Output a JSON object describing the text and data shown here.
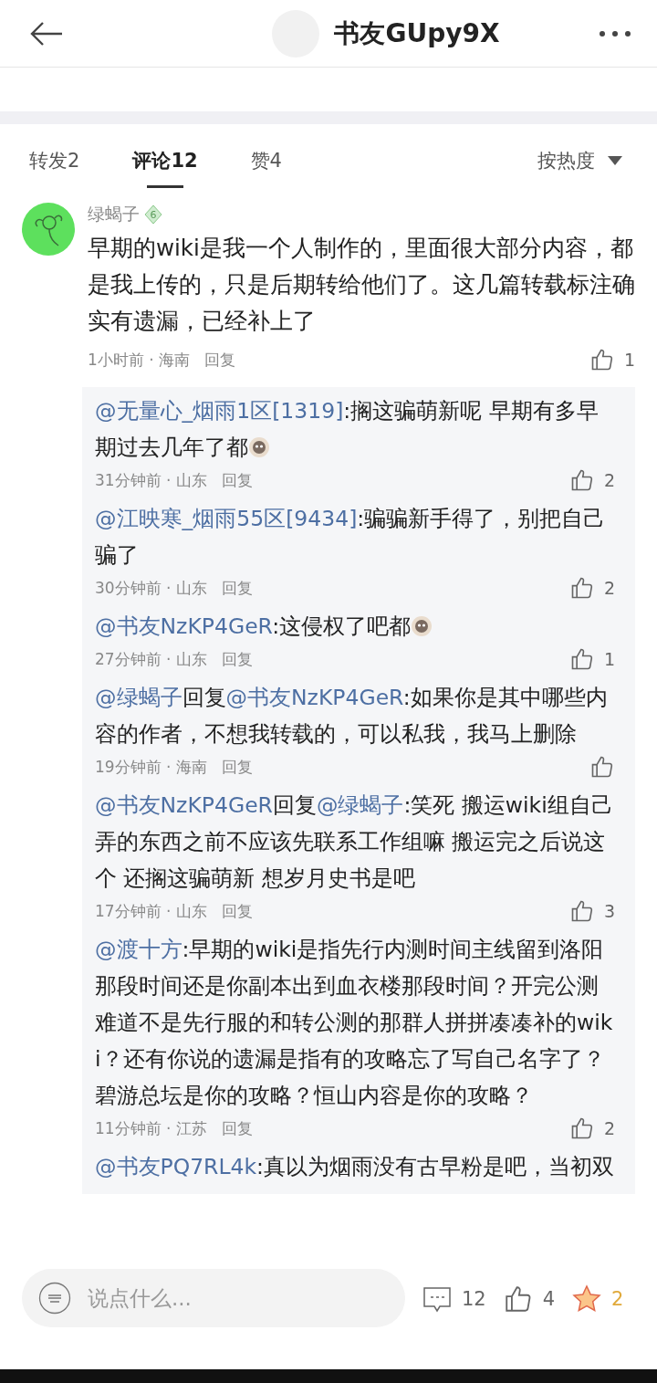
{
  "header": {
    "title": "书友GUpy9X"
  },
  "tabs": [
    {
      "label": "转发2",
      "selected": false
    },
    {
      "label": "评论12",
      "selected": true
    },
    {
      "label": "赞4",
      "selected": false
    }
  ],
  "sort": {
    "label": "按热度"
  },
  "comment": {
    "author": "绿蝎子",
    "level": "6",
    "text": "早期的wiki是我一个人制作的，里面很大部分内容，都是我上传的，只是后期转给他们了。这几篇转载标注确实有遗漏，已经补上了",
    "time": "1小时前 · 海南",
    "reply": "回复",
    "likes": "1",
    "replies": [
      {
        "segments": [
          {
            "kind": "mention",
            "text": "@无量心_烟雨1区[1319]"
          },
          {
            "kind": "plain",
            "text": ":搁这骗萌新呢 早期有多早期过去几年了都"
          },
          {
            "kind": "emoji"
          }
        ],
        "time": "31分钟前 · 山东",
        "reply": "回复",
        "likes": "2"
      },
      {
        "segments": [
          {
            "kind": "mention",
            "text": "@江映寒_烟雨55区[9434]"
          },
          {
            "kind": "plain",
            "text": ":骗骗新手得了，别把自己骗了"
          }
        ],
        "time": "30分钟前 · 山东",
        "reply": "回复",
        "likes": "2"
      },
      {
        "segments": [
          {
            "kind": "mention",
            "text": "@书友NzKP4GeR"
          },
          {
            "kind": "plain",
            "text": ":这侵权了吧都"
          },
          {
            "kind": "emoji"
          }
        ],
        "time": "27分钟前 · 山东",
        "reply": "回复",
        "likes": "1"
      },
      {
        "segments": [
          {
            "kind": "mention",
            "text": "@绿蝎子"
          },
          {
            "kind": "plain",
            "text": "回复"
          },
          {
            "kind": "mention",
            "text": "@书友NzKP4GeR"
          },
          {
            "kind": "plain",
            "text": ":如果你是其中哪些内容的作者，不想我转载的，可以私我，我马上删除"
          }
        ],
        "time": "19分钟前 · 海南",
        "reply": "回复"
      },
      {
        "segments": [
          {
            "kind": "mention",
            "text": "@书友NzKP4GeR"
          },
          {
            "kind": "plain",
            "text": "回复"
          },
          {
            "kind": "mention",
            "text": "@绿蝎子"
          },
          {
            "kind": "plain",
            "text": ":笑死  搬运wiki组自己弄的东西之前不应该先联系工作组嘛  搬运完之后说这个  还搁这骗萌新  想岁月史书是吧"
          }
        ],
        "time": "17分钟前 · 山东",
        "reply": "回复",
        "likes": "3"
      },
      {
        "segments": [
          {
            "kind": "mention",
            "text": "@渡十方"
          },
          {
            "kind": "plain",
            "text": ":早期的wiki是指先行内测时间主线留到洛阳那段时间还是你副本出到血衣楼那段时间？开完公测难道不是先行服的和转公测的那群人拼拼凑凑补的wiki？还有你说的遗漏是指有的攻略忘了写自己名字了？碧游总坛是你的攻略？恒山内容是你的攻略？"
          }
        ],
        "time": "11分钟前 · 江苏",
        "reply": "回复",
        "likes": "2"
      },
      {
        "segments": [
          {
            "kind": "mention",
            "text": "@书友PQ7RL4k"
          },
          {
            "kind": "plain",
            "text": ":真以为烟雨没有古早粉是吧，当初双"
          }
        ]
      }
    ]
  },
  "bottom_bar": {
    "placeholder": "说点什么...",
    "comments": "12",
    "likes": "4",
    "favorites": "2"
  }
}
